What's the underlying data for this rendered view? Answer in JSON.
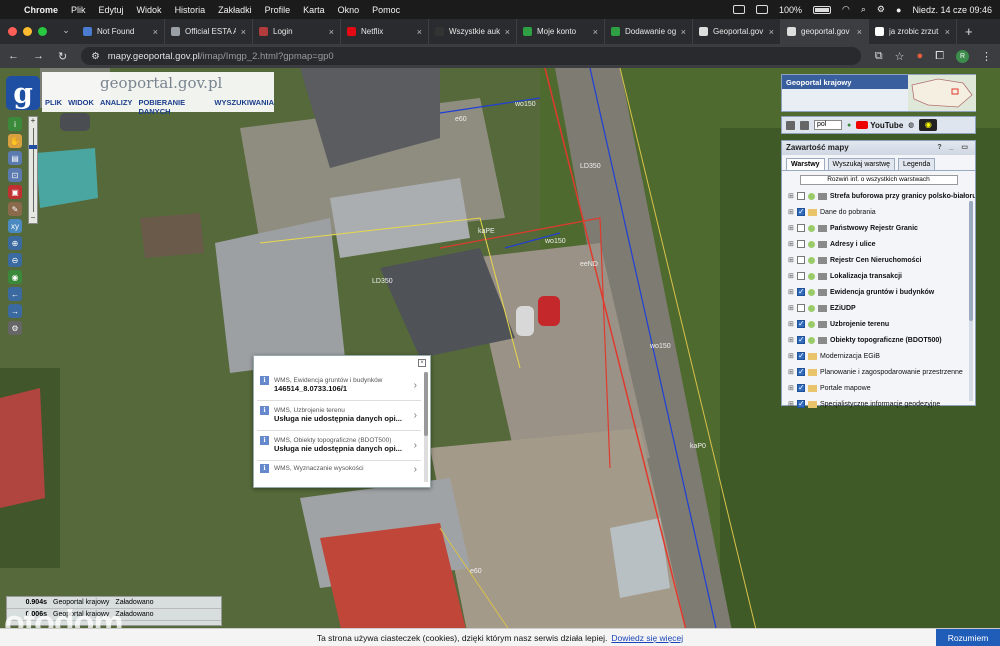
{
  "menubar": {
    "app": "Chrome",
    "items": [
      "Plik",
      "Edytuj",
      "Widok",
      "Historia",
      "Zakładki",
      "Profile",
      "Karta",
      "Okno",
      "Pomoc"
    ],
    "battery": "100%",
    "datetime": "Niedz. 14 cze  09:46"
  },
  "tabs": [
    {
      "title": "Not Found",
      "color": "#4a7bd0"
    },
    {
      "title": "Official ESTA A",
      "color": "#9aa0a6"
    },
    {
      "title": "Login",
      "color": "#b23b3b"
    },
    {
      "title": "Netflix",
      "color": "#e50914"
    },
    {
      "title": "Wszystkie auk",
      "color": "#333333"
    },
    {
      "title": "Moje konto",
      "color": "#2ea043"
    },
    {
      "title": "Dodawanie og",
      "color": "#2ea043"
    },
    {
      "title": "Geoportal.gov",
      "color": "#dddddd"
    },
    {
      "title": "geoportal.gov",
      "color": "#dddddd"
    },
    {
      "title": "ja zrobic zrzut",
      "color": "#ffffff"
    }
  ],
  "active_tab": 8,
  "address": {
    "host": "mapy.geoportal.gov.pl",
    "path": "/imap/Imgp_2.html?gpmap=gp0",
    "profile_initial": "R"
  },
  "app": {
    "brand": "geoportal.gov.pl",
    "menu": [
      "PLIK",
      "WIDOK",
      "ANALIZY",
      "POBIERANIE DANYCH",
      "WYSZUKIWANIA"
    ]
  },
  "right_panel": {
    "title": "Geoportal krajowy",
    "language": "pol",
    "youtube": "YouTube",
    "layers_title": "Zawartość mapy",
    "layers_tabs": [
      "Warstwy",
      "Wyszukaj warstwę",
      "Legenda"
    ],
    "expand_all": "Rozwiń inf. o wszystkich warstwach",
    "layers": [
      {
        "label": "Strefa buforowa przy granicy polsko-białoruskiej",
        "checked": false,
        "bold": true,
        "dot": true,
        "icon": true
      },
      {
        "label": "Dane do pobrania",
        "checked": true,
        "bold": false,
        "dot": false,
        "icon": false,
        "folder": true
      },
      {
        "label": "Państwowy Rejestr Granic",
        "checked": false,
        "bold": true,
        "dot": true,
        "icon": true
      },
      {
        "label": "Adresy i ulice",
        "checked": false,
        "bold": true,
        "dot": true,
        "icon": true
      },
      {
        "label": "Rejestr Cen Nieruchomości",
        "checked": false,
        "bold": true,
        "dot": true,
        "icon": true
      },
      {
        "label": "Lokalizacja transakcji",
        "checked": false,
        "bold": true,
        "dot": true,
        "icon": true
      },
      {
        "label": "Ewidencja gruntów i budynków",
        "checked": true,
        "bold": true,
        "dot": true,
        "icon": true
      },
      {
        "label": "EZiUDP",
        "checked": false,
        "bold": true,
        "dot": true,
        "icon": true
      },
      {
        "label": "Uzbrojenie terenu",
        "checked": true,
        "bold": true,
        "dot": true,
        "icon": true
      },
      {
        "label": "Obiekty topograficzne (BDOT500)",
        "checked": true,
        "bold": true,
        "dot": true,
        "icon": true
      },
      {
        "label": "Modernizacja EGiB",
        "checked": true,
        "bold": false,
        "dot": false,
        "icon": false,
        "folder": true
      },
      {
        "label": "Planowanie i zagospodarowanie przestrzenne",
        "checked": true,
        "bold": false,
        "dot": false,
        "icon": false,
        "folder": true
      },
      {
        "label": "Portale mapowe",
        "checked": true,
        "bold": false,
        "dot": false,
        "icon": false,
        "folder": true
      },
      {
        "label": "Specjalistyczne informacje geodezyjne",
        "checked": true,
        "bold": false,
        "dot": false,
        "icon": false,
        "folder": true
      }
    ]
  },
  "popup": {
    "rows": [
      {
        "sub": "WMS, Ewidencja gruntów i budynków",
        "value": "146514_8.0733.106/1"
      },
      {
        "sub": "WMS, Uzbrojenie terenu",
        "value": "Usługa nie udostępnia danych opi..."
      },
      {
        "sub": "WMS, Obiekty topograficzne (BDOT500)",
        "value": "Usługa nie udostępnia danych opi..."
      },
      {
        "sub": "WMS, Wyznaczanie wysokości",
        "value": ""
      }
    ]
  },
  "status": [
    {
      "time": "0.904s",
      "name": "Geoportal krajowy",
      "state": "Załadowano"
    },
    {
      "time": "0.006s",
      "name": "Geoportal krajowy",
      "state": "Załadowano"
    }
  ],
  "watermark": "otodom",
  "cookie": {
    "text": "Ta strona używa ciasteczek (cookies), dzięki którym nasz serwis działa lepiej.",
    "link": "Dowiedz się więcej",
    "button": "Rozumiem"
  },
  "map_labels": [
    "LD350",
    "wo150",
    "e60",
    "LD350",
    "kaPE",
    "wo150",
    "eeND",
    "wo150",
    "kaP0",
    "e60"
  ],
  "colors": {
    "accent": "#1f5db8",
    "header": "#3a5f9e",
    "parcel_line": "#e03a2e",
    "water_line": "#1f3fd6"
  }
}
